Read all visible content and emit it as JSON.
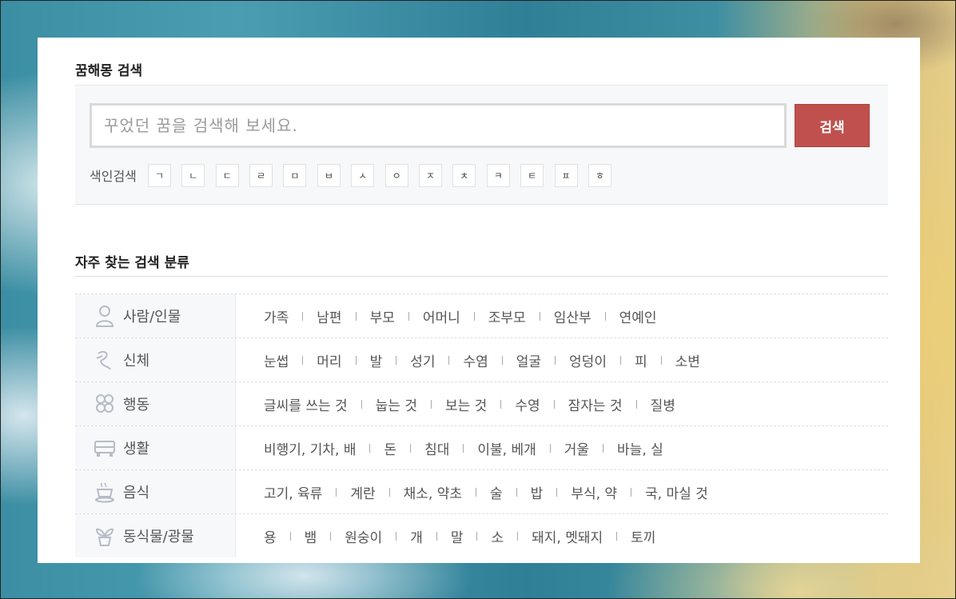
{
  "search": {
    "title": "꿈해몽 검색",
    "placeholder": "꾸었던 꿈을 검색해 보세요.",
    "button_label": "검색",
    "index_label": "색인검색",
    "index_keys": [
      "ㄱ",
      "ㄴ",
      "ㄷ",
      "ㄹ",
      "ㅁ",
      "ㅂ",
      "ㅅ",
      "ㅇ",
      "ㅈ",
      "ㅊ",
      "ㅋ",
      "ㅌ",
      "ㅍ",
      "ㅎ"
    ]
  },
  "categories": {
    "title": "자주 찾는 검색 분류",
    "rows": [
      {
        "name": "사람/인물",
        "icon": "person-icon",
        "items": [
          "가족",
          "남편",
          "부모",
          "어머니",
          "조부모",
          "임산부",
          "연예인"
        ]
      },
      {
        "name": "신체",
        "icon": "body-icon",
        "items": [
          "눈썹",
          "머리",
          "발",
          "성기",
          "수염",
          "얼굴",
          "엉덩이",
          "피",
          "소변"
        ]
      },
      {
        "name": "행동",
        "icon": "action-icon",
        "items": [
          "글씨를 쓰는 것",
          "눕는 것",
          "보는 것",
          "수영",
          "잠자는 것",
          "질병"
        ]
      },
      {
        "name": "생활",
        "icon": "car-icon",
        "items": [
          "비행기, 기차, 배",
          "돈",
          "침대",
          "이불, 베개",
          "거울",
          "바늘, 실"
        ]
      },
      {
        "name": "음식",
        "icon": "food-icon",
        "items": [
          "고기, 육류",
          "계란",
          "채소, 약초",
          "술",
          "밥",
          "부식, 약",
          "국, 마실 것"
        ]
      },
      {
        "name": "동식물/광물",
        "icon": "plant-icon",
        "items": [
          "용",
          "뱀",
          "원숭이",
          "개",
          "말",
          "소",
          "돼지, 멧돼지",
          "토끼"
        ]
      }
    ]
  },
  "colors": {
    "accent": "#c0504d",
    "icon": "#b5bcc6"
  }
}
